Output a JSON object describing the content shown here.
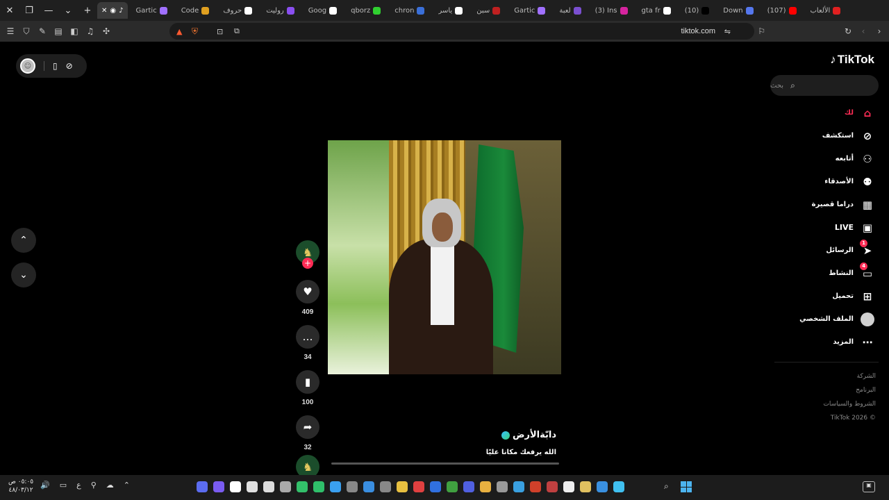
{
  "browser": {
    "tabs": [
      {
        "label": "الألعاب",
        "color": "#e02020"
      },
      {
        "label": "(107)",
        "color": "#ff0000"
      },
      {
        "label": "Down",
        "color": "#5577ee"
      },
      {
        "label": "(10)",
        "color": "#000000"
      },
      {
        "label": "gta fr",
        "color": "#ffffff"
      },
      {
        "label": "(3) Ins",
        "color": "#d6249f"
      },
      {
        "label": "لعبة",
        "color": "#7a4fd0"
      },
      {
        "label": "Gartic",
        "color": "#a070ff"
      },
      {
        "label": "سبن",
        "color": "#c02020"
      },
      {
        "label": "ياسر",
        "color": "#ffffff"
      },
      {
        "label": "chron",
        "color": "#3a6fd8"
      },
      {
        "label": "qborz",
        "color": "#30d030"
      },
      {
        "label": "Goog",
        "color": "#ffffff"
      },
      {
        "label": "روليت",
        "color": "#8a4ff0"
      },
      {
        "label": "حروف",
        "color": "#ffffff"
      },
      {
        "label": "Code",
        "color": "#e0a020"
      },
      {
        "label": "Gartic",
        "color": "#a070ff"
      }
    ],
    "url": "tiktok.com"
  },
  "tiktok": {
    "logo": "TikTok",
    "search_placeholder": "بحث",
    "nav": [
      {
        "label": "لك",
        "icon": "home-icon",
        "active": true,
        "badge": ""
      },
      {
        "label": "استكشف",
        "icon": "compass-icon",
        "active": false,
        "badge": ""
      },
      {
        "label": "أتابعه",
        "icon": "user-follow-icon",
        "active": false,
        "badge": ""
      },
      {
        "label": "الأصدقاء",
        "icon": "friends-icon",
        "active": false,
        "badge": ""
      },
      {
        "label": "دراما قصيرة",
        "icon": "film-icon",
        "active": false,
        "badge": ""
      },
      {
        "label": "LIVE",
        "icon": "live-tv-icon",
        "active": false,
        "badge": ""
      },
      {
        "label": "الرسائل",
        "icon": "send-icon",
        "active": false,
        "badge": "1"
      },
      {
        "label": "النشاط",
        "icon": "message-icon",
        "active": false,
        "badge": "4"
      },
      {
        "label": "تحميل",
        "icon": "upload-plus-icon",
        "active": false,
        "badge": ""
      },
      {
        "label": "الملف الشخصي",
        "icon": "profile-avatar-icon",
        "active": false,
        "badge": ""
      },
      {
        "label": "المزيد",
        "icon": "more-dots-icon",
        "active": false,
        "badge": ""
      }
    ],
    "footer": [
      "الشركة",
      "البرنامج",
      "الشروط والسياسات",
      "© 2026 TikTok"
    ],
    "video": {
      "author": "دابّةالأرض",
      "description": "الله يرفعك مكانا عليًا",
      "likes": "409",
      "comments": "34",
      "saves": "100",
      "shares": "32",
      "progress": 0.0
    }
  },
  "taskbar": {
    "time": "٠٥:٠٥ ص",
    "date": "٤٨/٠٣/١٢",
    "lang": "ع"
  }
}
